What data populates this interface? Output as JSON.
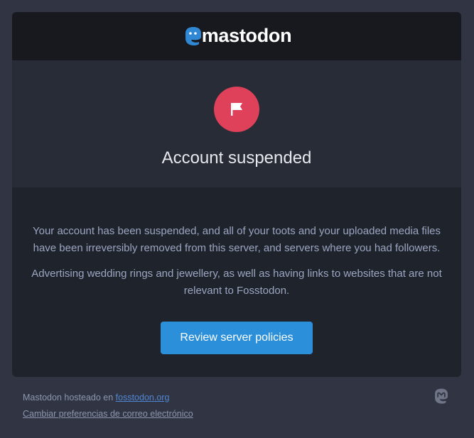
{
  "header": {
    "logo_text": "mastodon",
    "logo_icon": "mastodon-icon"
  },
  "hero": {
    "icon": "flag-icon",
    "icon_color": "#df405a",
    "title": "Account suspended"
  },
  "body": {
    "paragraph_1": "Your account has been suspended, and all of your toots and your uploaded media files have been irreversibly removed from this server, and servers where you had followers.",
    "paragraph_2": "Advertising wedding rings and jewellery, as well as having links to websites that are not relevant to Fosstodon.",
    "button_label": "Review server policies"
  },
  "footer": {
    "hosted_prefix": "Mastodon hosteado en ",
    "hosted_link": "fosstodon.org",
    "preferences_link": "Cambiar preferencias de correo electrónico",
    "icon": "mastodon-icon"
  },
  "colors": {
    "accent": "#2b90d9",
    "background": "#313543"
  }
}
